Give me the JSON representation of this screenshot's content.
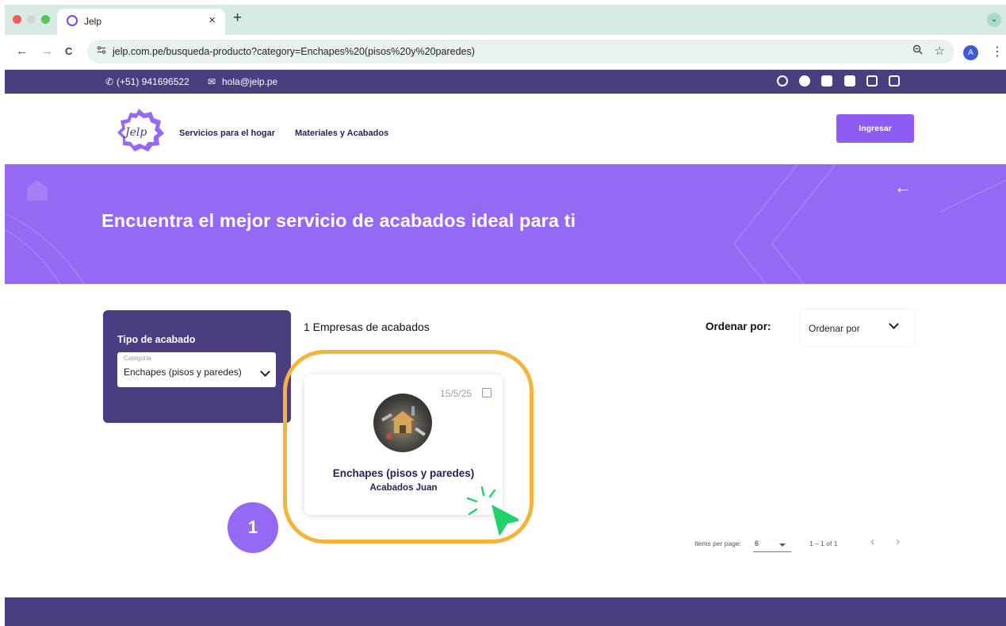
{
  "browser": {
    "tab_title": "Jelp",
    "tab_close": "×",
    "new_tab": "+",
    "tab_menu": "⌄",
    "nav_back": "←",
    "nav_forward": "→",
    "nav_reload": "C",
    "url": "jelp.com.pe/busqueda-producto?category=Enchapes%20(pisos%20y%20paredes)",
    "zoom_icon": "⚲",
    "bookmark_icon": "☆",
    "profile_initial": "A",
    "menu_icon": "⋮"
  },
  "topbar": {
    "phone": "(+51) 941696522",
    "email": "hola@jelp.pe",
    "phone_icon": "✆",
    "email_icon": "✉"
  },
  "header": {
    "logo_text": "Jelp",
    "nav": [
      "Servicios para el hogar",
      "Materiales y Acabados"
    ],
    "login_label": "Ingresar"
  },
  "hero": {
    "title": "Encuentra el mejor servicio de acabados ideal para ti",
    "back_icon": "←"
  },
  "filter": {
    "title": "Tipo de acabado",
    "select_label": "Categoria",
    "select_value": "Enchapes (pisos y paredes)"
  },
  "results": {
    "count_label": "1 Empresas de acabados",
    "sort_label": "Ordenar por:",
    "sort_value": "Ordenar por"
  },
  "card": {
    "date": "15/5/25",
    "title": "Enchapes (pisos y paredes)",
    "company": "Acabados Juan"
  },
  "tutorial": {
    "step": "1"
  },
  "paginator": {
    "items_label": "Items per page:",
    "items_value": "6",
    "range": "1 – 1 of 1",
    "prev": "‹",
    "next": "›"
  },
  "colors": {
    "brand_dark": "#4a3d80",
    "brand_purple": "#9669f4",
    "button": "#8d5cf3",
    "highlight": "#f4b43a",
    "cursor": "#1fd36a"
  }
}
